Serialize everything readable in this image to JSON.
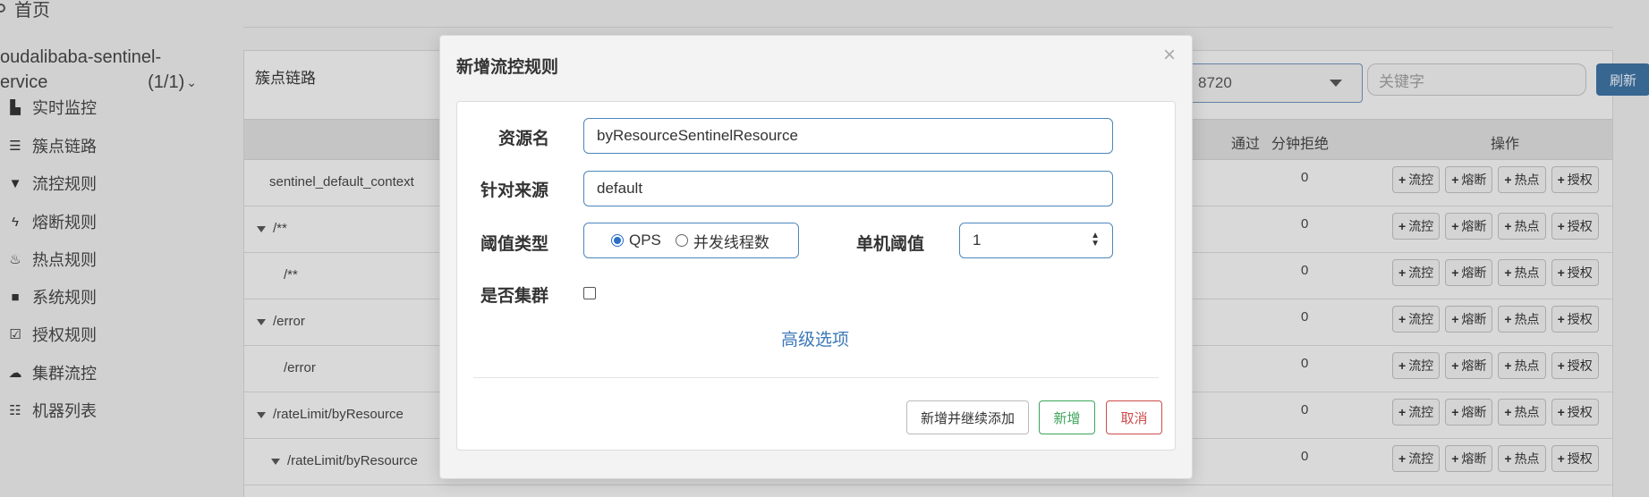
{
  "sidebar": {
    "home": "首页",
    "app_name_line1": "oudalibaba-sentinel-",
    "app_name_line2": "ervice",
    "app_count": "(1/1)",
    "items": [
      {
        "label": "实时监控",
        "icon": "bar-chart-icon"
      },
      {
        "label": "簇点链路",
        "icon": "list-icon"
      },
      {
        "label": "流控规则",
        "icon": "filter-icon"
      },
      {
        "label": "熔断规则",
        "icon": "flash-icon"
      },
      {
        "label": "热点规则",
        "icon": "fire-icon"
      },
      {
        "label": "系统规则",
        "icon": "lock-icon"
      },
      {
        "label": "授权规则",
        "icon": "check-square-icon"
      },
      {
        "label": "集群流控",
        "icon": "cloud-icon"
      },
      {
        "label": "机器列表",
        "icon": "list-bullets-icon"
      }
    ]
  },
  "panel": {
    "title": "簇点链路",
    "machine_select": "8720",
    "keyword_placeholder": "关键字",
    "refresh": "刷新",
    "headers": {
      "pass_partial": "通过",
      "reject": "分钟拒绝",
      "ops": "操作"
    },
    "op_labels": {
      "flow": "流控",
      "degrade": "熔断",
      "hot": "热点",
      "auth": "授权"
    },
    "rows": [
      {
        "resource": "sentinel_default_context",
        "reject": "0",
        "expandable": false
      },
      {
        "resource": "/**",
        "reject": "0",
        "expandable": true
      },
      {
        "resource": "/**",
        "reject": "0",
        "expandable": false
      },
      {
        "resource": "/error",
        "reject": "0",
        "expandable": true
      },
      {
        "resource": "/error",
        "reject": "0",
        "expandable": false
      },
      {
        "resource": "/rateLimit/byResource",
        "reject": "0",
        "expandable": true
      },
      {
        "resource": "/rateLimit/byResource",
        "reject": "0",
        "expandable": true
      }
    ]
  },
  "modal": {
    "title": "新增流控规则",
    "close": "×",
    "resource_label": "资源名",
    "resource_value": "byResourceSentinelResource",
    "origin_label": "针对来源",
    "origin_value": "default",
    "grade_label": "阈值类型",
    "grade_options": [
      "QPS",
      "并发线程数"
    ],
    "grade_selected": "QPS",
    "threshold_label": "单机阈值",
    "threshold_value": "1",
    "cluster_label": "是否集群",
    "cluster_checked": false,
    "advanced_link": "高级选项",
    "btn_continue": "新增并继续添加",
    "btn_add": "新增",
    "btn_cancel": "取消"
  }
}
